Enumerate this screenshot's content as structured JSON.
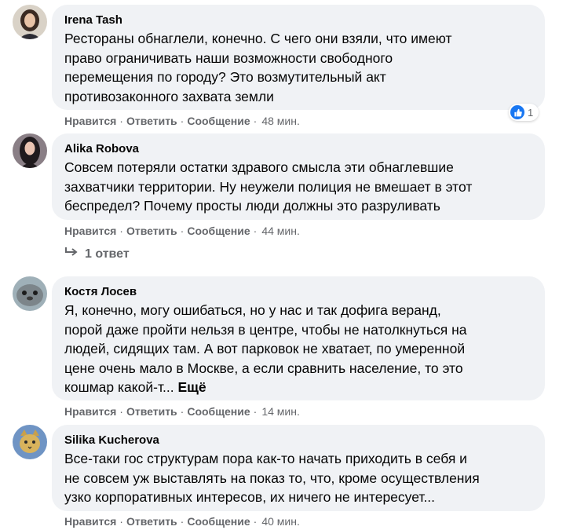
{
  "comments": [
    {
      "author": "Irena Tash",
      "text": "Рестораны обнаглели, конечно. С чего они взяли, что имеют\nправо ограничивать наши возможности свободного\nперемещения по городу? Это возмутительный акт\nпротивозаконного захвата земли",
      "like": "Нравится",
      "reply": "Ответить",
      "message": "Сообщение",
      "time": "48 мин.",
      "reaction_count": "1",
      "avatar_icon": "avatar-woman-dark-hair-icon"
    },
    {
      "author": "Alika Robova",
      "text": "Совсем потеряли остатки здравого смысла эти обнаглевшие\nзахватчики территории. Ну неужели полиция не вмешает в этот\nбеспредел? Почему просты люди должны это разруливать",
      "like": "Нравится",
      "reply": "Ответить",
      "message": "Сообщение",
      "time": "44 мин.",
      "replies_label": "1 ответ",
      "avatar_icon": "avatar-woman-long-hair-icon"
    },
    {
      "author": "Костя Лосев",
      "text": "Я, конечно, могу ошибаться, но у нас и так дофига веранд,\nпорой даже пройти нельзя в центре, чтобы не натолкнуться на\nлюдей, сидящих там. А вот парковок не хватает, по умеренной\nцене очень мало в Москве, а если сравнить население, то это\nкошмар какой-т...",
      "more": "Ещё",
      "like": "Нравится",
      "reply": "Ответить",
      "message": "Сообщение",
      "time": "14 мин.",
      "avatar_icon": "avatar-seal-icon"
    },
    {
      "author": "Silika Kucherova",
      "text": "Все-таки гос структурам пора как-то начать приходить в себя и\nне совсем уж выставлять на показ то, что, кроме осуществления\nузко корпоративных интересов, их ничего не интересует...",
      "like": "Нравится",
      "reply": "Ответить",
      "message": "Сообщение",
      "time": "40 мин.",
      "avatar_icon": "avatar-cat-icon"
    }
  ],
  "colors": {
    "bubble": "#f0f2f5",
    "meta": "#65676b",
    "text": "#050505",
    "like_blue": "#1877f2"
  }
}
